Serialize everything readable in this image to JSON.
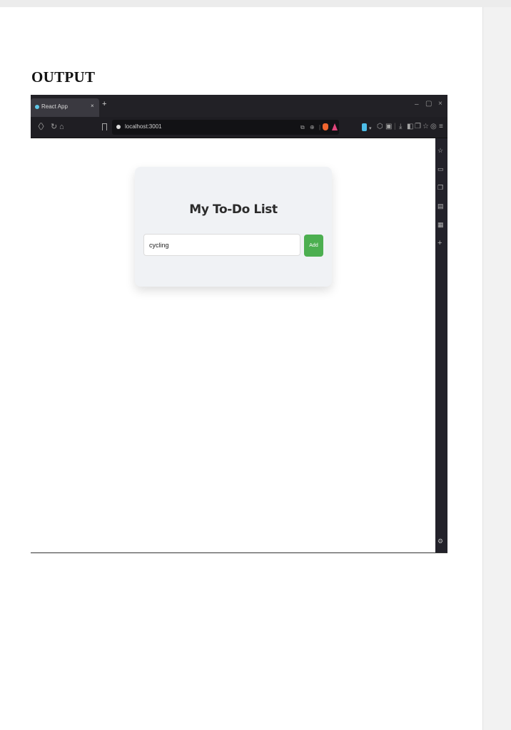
{
  "document": {
    "heading": "OUTPUT"
  },
  "browser": {
    "tab": {
      "title": "React App",
      "close_glyph": "×",
      "new_tab_glyph": "+"
    },
    "window_controls": {
      "minimize": "–",
      "maximize": "▢",
      "close": "×"
    },
    "nav": {
      "back_glyph": "〈",
      "forward_glyph": "〉",
      "reload_glyph": "↻",
      "home_glyph": "⌂"
    },
    "address_bar": {
      "url": "localhost:3001"
    },
    "accent_colors": {
      "brave_shield": "#f0652f",
      "rewards": "#e0457b",
      "extension": "#4dbce6"
    }
  },
  "app": {
    "title": "My To-Do List",
    "input": {
      "value": "cycling",
      "placeholder": ""
    },
    "add_button_label": "Add",
    "accent_color": "#4caf50"
  }
}
